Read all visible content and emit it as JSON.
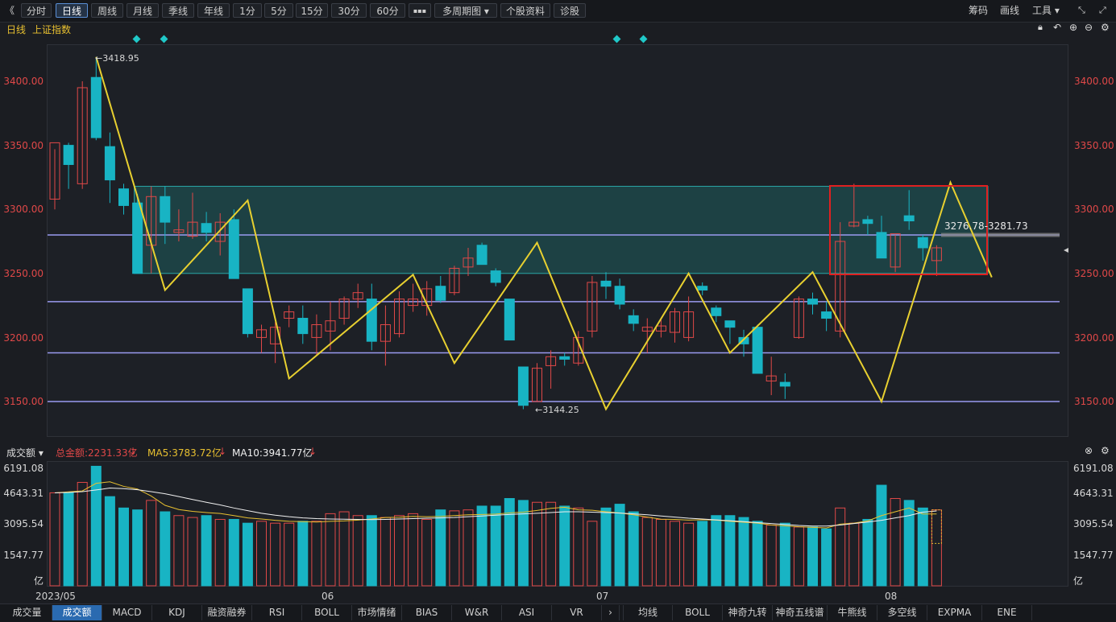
{
  "toolbar": {
    "back": "《",
    "periods": [
      "分时",
      "日线",
      "周线",
      "月线",
      "季线",
      "年线",
      "1分",
      "5分",
      "15分",
      "30分",
      "60分"
    ],
    "active_period": "日线",
    "more": "▪▪▪",
    "multi": "多周期图 ▾",
    "profile": "个股资料",
    "diagnose": "诊股",
    "right": [
      "筹码",
      "画线",
      "工具 ▾"
    ]
  },
  "info": {
    "period": "日线",
    "name": "上证指数"
  },
  "price_axis": [
    "3400.00",
    "3350.00",
    "3300.00",
    "3250.00",
    "3200.00",
    "3150.00"
  ],
  "annotations": {
    "high": "3418.95",
    "low": "3144.25",
    "range": "3276.78-3281.73"
  },
  "volume_header": {
    "selector": "成交额 ▾",
    "total": "总金额:2231.33亿",
    "ma5": "MA5:3783.72亿",
    "ma10": "MA10:3941.77亿"
  },
  "volume_axis": [
    "6191.08",
    "4643.31",
    "3095.54",
    "1547.77",
    "亿"
  ],
  "x_labels": [
    "2023/05",
    "06",
    "07",
    "08"
  ],
  "tabs_left": [
    "成交量",
    "成交额",
    "MACD",
    "KDJ",
    "融资融券",
    "RSI",
    "BOLL",
    "市场情绪",
    "BIAS",
    "W&R",
    "ASI",
    "VR"
  ],
  "tabs_right": [
    "均线",
    "BOLL",
    "神奇九转",
    "神奇五线谱",
    "牛熊线",
    "多空线",
    "EXPMA",
    "ENE"
  ],
  "active_tab": "成交额",
  "colors": {
    "up": "#e04848",
    "down": "#18b4c4",
    "zigzag": "#e8d030",
    "band": "#1f6b6b",
    "hline": "#9a9af0",
    "box": "#e02020"
  },
  "chart_data": {
    "type": "candlestick",
    "price_range": [
      3130,
      3425
    ],
    "candles": [
      [
        3308,
        3352,
        3300,
        3347
      ],
      [
        3350,
        3335,
        3316,
        3352
      ],
      [
        3320,
        3395,
        3316,
        3400
      ],
      [
        3403,
        3356,
        3354,
        3419
      ],
      [
        3349,
        3323,
        3305,
        3360
      ],
      [
        3316,
        3303,
        3296,
        3320
      ],
      [
        3305,
        3250,
        3250,
        3312
      ],
      [
        3272,
        3310,
        3250,
        3318
      ],
      [
        3310,
        3290,
        3273,
        3318
      ],
      [
        3282,
        3284,
        3275,
        3300
      ],
      [
        3279,
        3290,
        3277,
        3313
      ],
      [
        3289,
        3282,
        3275,
        3298
      ],
      [
        3275,
        3290,
        3264,
        3297
      ],
      [
        3292,
        3246,
        3246,
        3300
      ],
      [
        3238,
        3203,
        3200,
        3238
      ],
      [
        3200,
        3206,
        3188,
        3210
      ],
      [
        3195,
        3208,
        3180,
        3212
      ],
      [
        3215,
        3220,
        3208,
        3225
      ],
      [
        3215,
        3203,
        3195,
        3225
      ],
      [
        3200,
        3210,
        3186,
        3218
      ],
      [
        3205,
        3213,
        3190,
        3228
      ],
      [
        3215,
        3230,
        3210,
        3232
      ],
      [
        3230,
        3235,
        3223,
        3242
      ],
      [
        3230,
        3197,
        3190,
        3242
      ],
      [
        3197,
        3210,
        3178,
        3225
      ],
      [
        3203,
        3230,
        3200,
        3236
      ],
      [
        3225,
        3230,
        3220,
        3242
      ],
      [
        3225,
        3238,
        3217,
        3244
      ],
      [
        3240,
        3229,
        3227,
        3248
      ],
      [
        3235,
        3254,
        3233,
        3256
      ],
      [
        3255,
        3262,
        3248,
        3270
      ],
      [
        3272,
        3257,
        3257,
        3274
      ],
      [
        3252,
        3243,
        3240,
        3254
      ],
      [
        3230,
        3198,
        3198,
        3230
      ],
      [
        3177,
        3147,
        3144,
        3177
      ],
      [
        3150,
        3176,
        3150,
        3180
      ],
      [
        3178,
        3185,
        3160,
        3190
      ],
      [
        3185,
        3183,
        3178,
        3188
      ],
      [
        3180,
        3200,
        3178,
        3205
      ],
      [
        3205,
        3243,
        3200,
        3248
      ],
      [
        3244,
        3240,
        3230,
        3251
      ],
      [
        3240,
        3226,
        3222,
        3246
      ],
      [
        3217,
        3211,
        3205,
        3222
      ],
      [
        3205,
        3208,
        3188,
        3215
      ],
      [
        3205,
        3209,
        3200,
        3215
      ],
      [
        3204,
        3220,
        3196,
        3223
      ],
      [
        3200,
        3220,
        3197,
        3232
      ],
      [
        3240,
        3237,
        3233,
        3243
      ],
      [
        3223,
        3217,
        3212,
        3225
      ],
      [
        3213,
        3208,
        3195,
        3213
      ],
      [
        3200,
        3195,
        3185,
        3206
      ],
      [
        3208,
        3172,
        3172,
        3210
      ],
      [
        3166,
        3170,
        3155,
        3185
      ],
      [
        3165,
        3162,
        3152,
        3172
      ],
      [
        3200,
        3230,
        3199,
        3232
      ],
      [
        3230,
        3226,
        3218,
        3235
      ],
      [
        3220,
        3215,
        3205,
        3228
      ],
      [
        3205,
        3275,
        3200,
        3290
      ],
      [
        3287,
        3290,
        3286,
        3320
      ],
      [
        3292,
        3289,
        3280,
        3295
      ],
      [
        3282,
        3262,
        3262,
        3295
      ],
      [
        3255,
        3281,
        3251,
        3280
      ],
      [
        3295,
        3291,
        3284,
        3315
      ],
      [
        3278,
        3270,
        3260,
        3280
      ],
      [
        3260,
        3270,
        3248,
        3272
      ]
    ],
    "volume_range": [
      0,
      6191.08
    ],
    "volume": [
      4900,
      4900,
      5450,
      6300,
      4700,
      4100,
      4000,
      4500,
      3900,
      3700,
      3600,
      3700,
      3500,
      3500,
      3300,
      3400,
      3300,
      3300,
      3400,
      3400,
      3800,
      3900,
      3700,
      3700,
      3600,
      3700,
      3800,
      3500,
      4000,
      3950,
      4000,
      4200,
      4200,
      4600,
      4500,
      4400,
      4400,
      4200,
      4100,
      3400,
      4100,
      4300,
      3900,
      3600,
      3500,
      3400,
      3300,
      3400,
      3700,
      3700,
      3600,
      3400,
      3200,
      3300,
      3100,
      3100,
      3000,
      4100,
      3300,
      3500,
      5300,
      4600,
      4500,
      4100,
      4000
    ],
    "ma5": [
      4900,
      4950,
      5000,
      5400,
      5480,
      5240,
      5100,
      4730,
      4240,
      4020,
      3920,
      3860,
      3810,
      3700,
      3580,
      3520,
      3450,
      3400,
      3380,
      3360,
      3400,
      3420,
      3460,
      3520,
      3600,
      3610,
      3660,
      3640,
      3660,
      3700,
      3740,
      3760,
      3780,
      3840,
      3880,
      3970,
      4080,
      4140,
      4000,
      3980,
      3900,
      3840,
      3740,
      3620,
      3510,
      3500,
      3460,
      3480,
      3460,
      3400,
      3350,
      3300,
      3200,
      3160,
      3110,
      3080,
      3050,
      3250,
      3300,
      3420,
      3700,
      3900,
      4100,
      3783.72,
      3783.72
    ],
    "ma10": [
      4900,
      4920,
      4960,
      5050,
      5150,
      5120,
      5060,
      4960,
      4850,
      4700,
      4550,
      4400,
      4260,
      4100,
      3960,
      3820,
      3720,
      3640,
      3580,
      3540,
      3520,
      3510,
      3500,
      3490,
      3500,
      3520,
      3540,
      3560,
      3580,
      3600,
      3640,
      3680,
      3720,
      3760,
      3790,
      3820,
      3860,
      3900,
      3900,
      3880,
      3860,
      3830,
      3790,
      3740,
      3680,
      3620,
      3560,
      3520,
      3470,
      3430,
      3380,
      3330,
      3280,
      3230,
      3180,
      3150,
      3150,
      3200,
      3280,
      3360,
      3450,
      3580,
      3700,
      3880,
      3941.77
    ],
    "zigzag": [
      [
        3,
        3419
      ],
      [
        8,
        3237
      ],
      [
        14,
        3307
      ],
      [
        17,
        3168
      ],
      [
        26,
        3249
      ],
      [
        29,
        3180
      ],
      [
        35,
        3274
      ],
      [
        40,
        3144
      ],
      [
        46,
        3250
      ],
      [
        49,
        3188
      ],
      [
        55,
        3251
      ],
      [
        60,
        3150
      ],
      [
        65,
        3321
      ],
      [
        68,
        3247
      ]
    ],
    "horizontal_lines": [
      3280,
      3228,
      3188,
      3150
    ],
    "band": [
      3318,
      3250
    ]
  }
}
